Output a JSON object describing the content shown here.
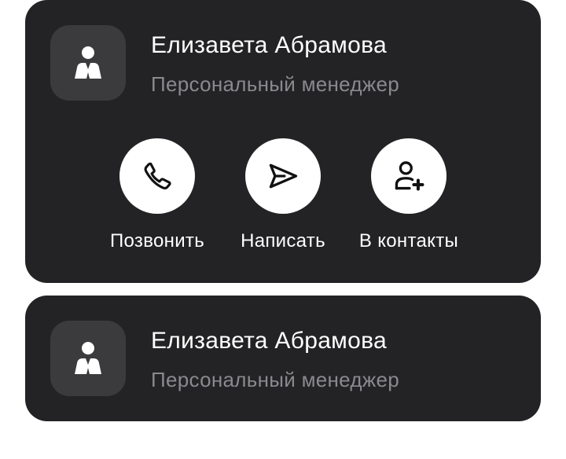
{
  "cards": [
    {
      "name": "Елизавета Абрамова",
      "role": "Персональный менеджер",
      "avatar_icon": "person-icon",
      "actions": [
        {
          "label": "Позвонить",
          "icon": "phone-icon"
        },
        {
          "label": "Написать",
          "icon": "send-icon"
        },
        {
          "label": "В контакты",
          "icon": "add-contact-icon"
        }
      ]
    },
    {
      "name": "Елизавета Абрамова",
      "role": "Персональный менеджер",
      "avatar_icon": "person-icon"
    }
  ],
  "colors": {
    "card_bg": "#232325",
    "avatar_bg": "#3b3b3e",
    "primary_text": "#ffffff",
    "secondary_text": "#8a8a8e",
    "action_bg": "#ffffff"
  }
}
